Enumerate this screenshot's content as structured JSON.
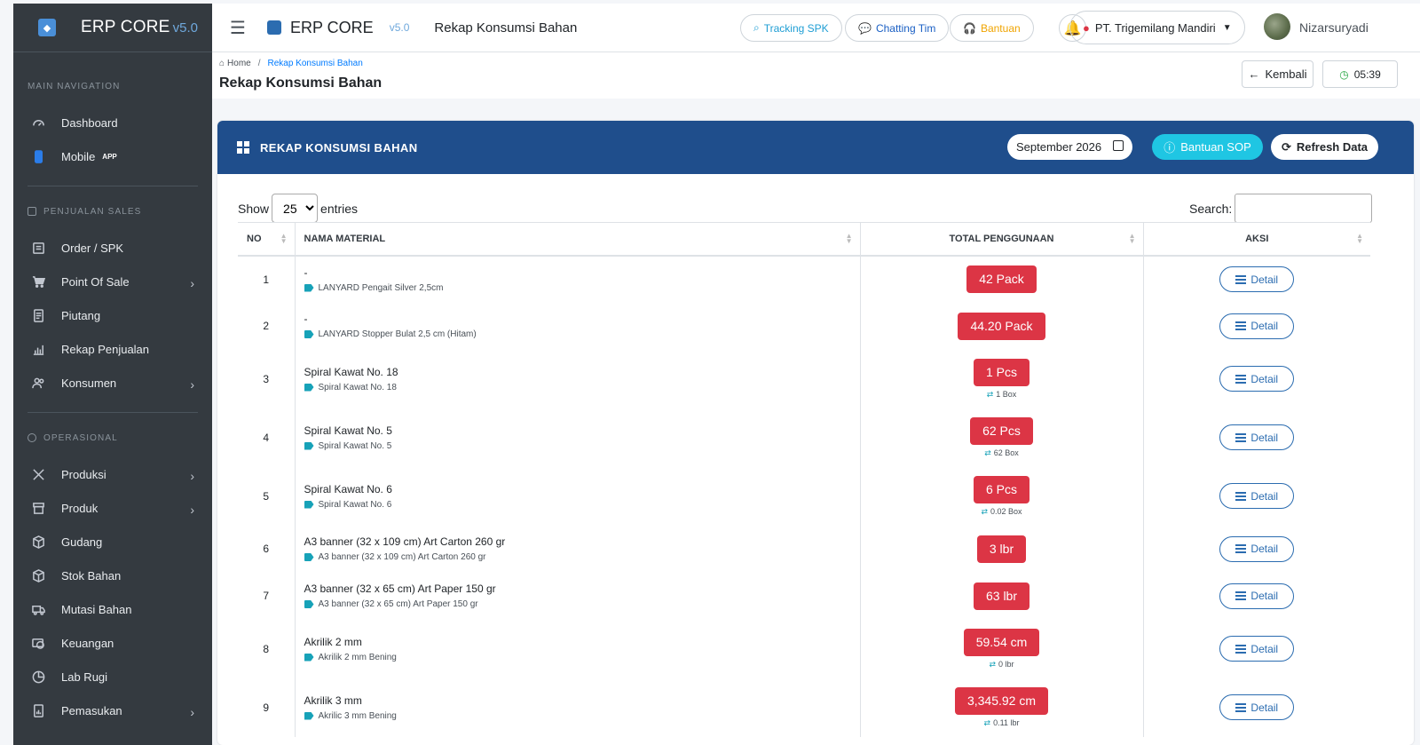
{
  "sidebar": {
    "brand": "ERP CORE",
    "version": "v5.0",
    "sections": {
      "main": "MAIN NAVIGATION",
      "sales": "PENJUALAN SALES",
      "ops": "OPERASIONAL"
    },
    "items": [
      {
        "label": "Dashboard"
      },
      {
        "label": "Mobile",
        "badge": "APP"
      },
      {
        "label": "Order / SPK"
      },
      {
        "label": "Point Of Sale"
      },
      {
        "label": "Piutang"
      },
      {
        "label": "Rekap Penjualan"
      },
      {
        "label": "Konsumen"
      },
      {
        "label": "Produksi"
      },
      {
        "label": "Produk"
      },
      {
        "label": "Gudang"
      },
      {
        "label": "Stok Bahan"
      },
      {
        "label": "Mutasi Bahan"
      },
      {
        "label": "Keuangan"
      },
      {
        "label": "Lab Rugi"
      },
      {
        "label": "Pemasukan"
      }
    ]
  },
  "topbar": {
    "brand": "ERP CORE",
    "version": "v5.0",
    "page": "Rekap Konsumsi Bahan",
    "tracking": "Tracking SPK",
    "chatting": "Chatting Tim",
    "bantuan": "Bantuan",
    "company": "PT. Trigemilang Mandiri",
    "user": "Nizarsuryadi"
  },
  "header": {
    "breadcrumb_home": "Home",
    "breadcrumb_current": "Rekap Konsumsi Bahan",
    "title": "Rekap Konsumsi Bahan",
    "back": "Kembali",
    "time": "05:39"
  },
  "card": {
    "title": "REKAP KONSUMSI BAHAN",
    "month": "September 2026",
    "sop": "Bantuan SOP",
    "refresh": "Refresh Data"
  },
  "table": {
    "show_label": "Show",
    "entries_value": "25",
    "entries_label": "entries",
    "search_label": "Search:",
    "columns": [
      "NO",
      "NAMA MATERIAL",
      "TOTAL PENGGUNAAN",
      "AKSI"
    ],
    "detail_label": "Detail",
    "rows": [
      {
        "no": "1",
        "name": "-",
        "sub": "LANYARD Pengait Silver 2,5cm",
        "qty": "42 Pack",
        "conv": ""
      },
      {
        "no": "2",
        "name": "-",
        "sub": "LANYARD Stopper Bulat 2,5 cm (Hitam)",
        "qty": "44.20 Pack",
        "conv": ""
      },
      {
        "no": "3",
        "name": "Spiral Kawat No. 18",
        "sub": "Spiral Kawat No. 18",
        "qty": "1 Pcs",
        "conv": "1 Box"
      },
      {
        "no": "4",
        "name": "Spiral Kawat No. 5",
        "sub": "Spiral Kawat No. 5",
        "qty": "62 Pcs",
        "conv": "62 Box"
      },
      {
        "no": "5",
        "name": "Spiral Kawat No. 6",
        "sub": "Spiral Kawat No. 6",
        "qty": "6 Pcs",
        "conv": "0.02 Box"
      },
      {
        "no": "6",
        "name": "A3 banner (32 x 109 cm) Art Carton 260 gr",
        "sub": "A3 banner (32 x 109 cm) Art Carton 260 gr",
        "qty": "3 lbr",
        "conv": ""
      },
      {
        "no": "7",
        "name": "A3 banner (32 x 65 cm) Art Paper 150 gr",
        "sub": "A3 banner (32 x 65 cm) Art Paper 150 gr",
        "qty": "63 lbr",
        "conv": ""
      },
      {
        "no": "8",
        "name": "Akrilik 2 mm",
        "sub": "Akrilik 2 mm Bening",
        "qty": "59.54 cm",
        "conv": "0 lbr"
      },
      {
        "no": "9",
        "name": "Akrilik 3 mm",
        "sub": "Akrilic 3 mm Bening",
        "qty": "3,345.92 cm",
        "conv": "0.11 lbr"
      }
    ]
  }
}
